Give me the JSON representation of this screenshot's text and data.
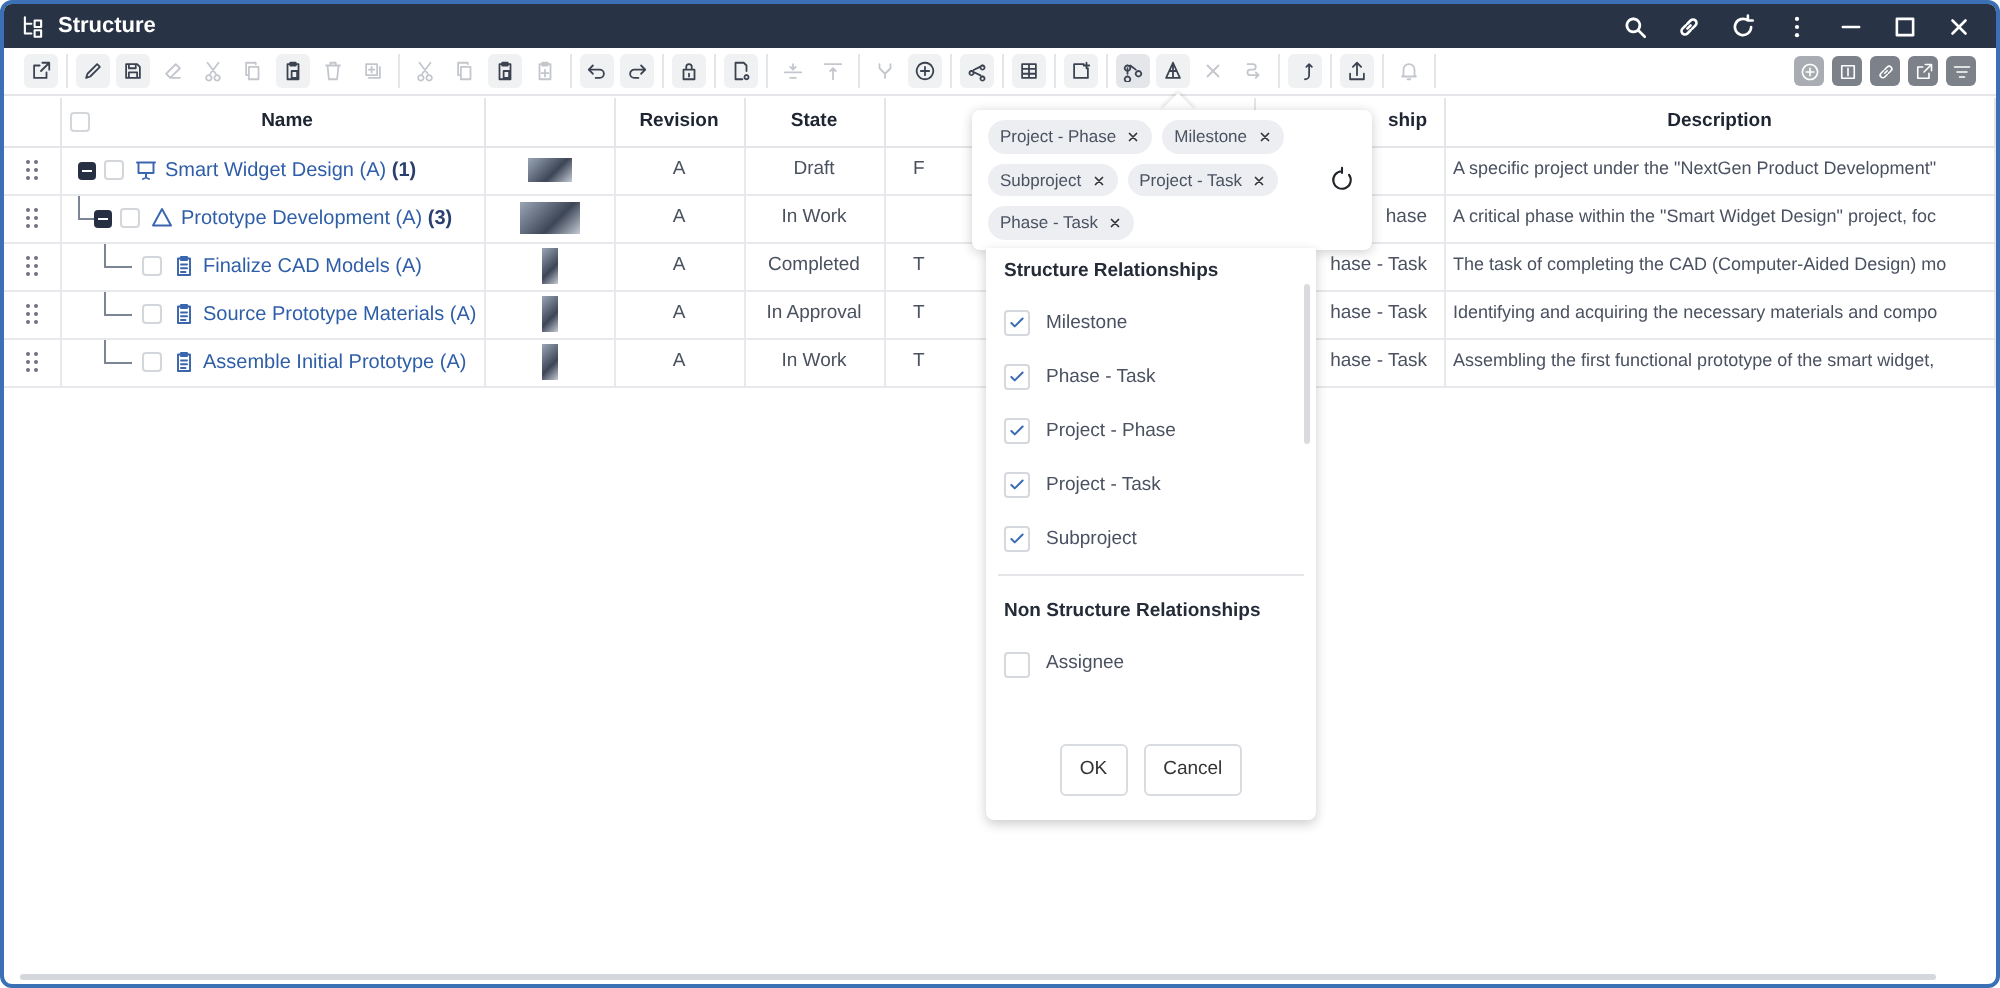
{
  "window": {
    "title": "Structure"
  },
  "toolbar": [
    [
      {
        "disabled": false
      }
    ],
    [
      {
        "disabled": false
      },
      {
        "disabled": false
      },
      {
        "disabled": true
      },
      {
        "disabled": true
      },
      {
        "disabled": true
      },
      {
        "disabled": false
      },
      {
        "disabled": true
      },
      {
        "disabled": true
      }
    ],
    [
      {
        "disabled": true
      },
      {
        "disabled": true
      },
      {
        "disabled": false
      },
      {
        "disabled": true
      }
    ],
    [
      {
        "disabled": false
      },
      {
        "disabled": false
      }
    ],
    [
      {
        "disabled": false
      }
    ],
    [
      {
        "disabled": false
      }
    ],
    [
      {
        "disabled": true
      },
      {
        "disabled": true
      }
    ],
    [
      {
        "disabled": true
      },
      {
        "disabled": false
      }
    ],
    [
      {
        "disabled": false
      }
    ],
    [
      {
        "disabled": false
      }
    ],
    [
      {
        "disabled": false
      }
    ],
    [
      {
        "disabled": false,
        "selected": true
      },
      {
        "disabled": false
      },
      {
        "disabled": true
      },
      {
        "disabled": true
      }
    ],
    [
      {
        "disabled": false
      }
    ],
    [
      {
        "disabled": false
      }
    ],
    [
      {
        "disabled": true
      }
    ]
  ],
  "toolbar_right": [
    {
      "disabled": true
    },
    {
      "disabled": false
    },
    {
      "disabled": false
    },
    {
      "disabled": false
    },
    {
      "disabled": false
    }
  ],
  "table": {
    "columns": [
      "Name",
      "Revision",
      "State",
      "ship",
      "Description"
    ],
    "header_checked": false,
    "rows": [
      {
        "kind": "project",
        "name": "Smart Widget Design (A)",
        "count": "(1)",
        "checked": false,
        "expanded": true,
        "revision": "A",
        "state": "Draft",
        "column_6": "F",
        "description": "A specific project under the \"NextGen Product Development\"",
        "children": [
          {
            "kind": "phase",
            "name": "Prototype Development (A)",
            "count": "(3)",
            "checked": false,
            "expanded": true,
            "revision": "A",
            "state": "In Work",
            "column_7": "hase",
            "description": "A critical phase within the \"Smart Widget Design\" project, foc",
            "children": [
              {
                "kind": "task",
                "name": "Finalize CAD Models (A)",
                "checked": false,
                "revision": "A",
                "state": "Completed",
                "column_6": "T",
                "column_7": "hase - Task",
                "description": "The task of completing the CAD (Computer-Aided Design) mo"
              },
              {
                "kind": "task",
                "name": "Source Prototype Materials (A)",
                "checked": false,
                "revision": "A",
                "state": "In Approval",
                "column_6": "T",
                "column_7": "hase - Task",
                "description": "Identifying and acquiring the necessary materials and compo"
              },
              {
                "kind": "task",
                "name": "Assemble Initial Prototype (A)",
                "checked": false,
                "revision": "A",
                "state": "In Work",
                "column_6": "T",
                "column_7": "hase - Task",
                "description": "Assembling the first functional prototype of the smart widget,"
              }
            ]
          }
        ]
      }
    ]
  },
  "filter_popup": {
    "chips": [
      "Project - Phase",
      "Milestone",
      "Subproject",
      "Project - Task",
      "Phase - Task"
    ],
    "sections": [
      {
        "title": "Structure Relationships",
        "items": [
          {
            "label": "Milestone",
            "checked": true
          },
          {
            "label": "Phase - Task",
            "checked": true
          },
          {
            "label": "Project - Phase",
            "checked": true
          },
          {
            "label": "Project - Task",
            "checked": true
          },
          {
            "label": "Subproject",
            "checked": true
          }
        ]
      },
      {
        "title": "Non Structure Relationships",
        "items": [
          {
            "label": "Assignee",
            "checked": false
          }
        ]
      }
    ],
    "buttons": [
      "OK",
      "Cancel"
    ]
  }
}
